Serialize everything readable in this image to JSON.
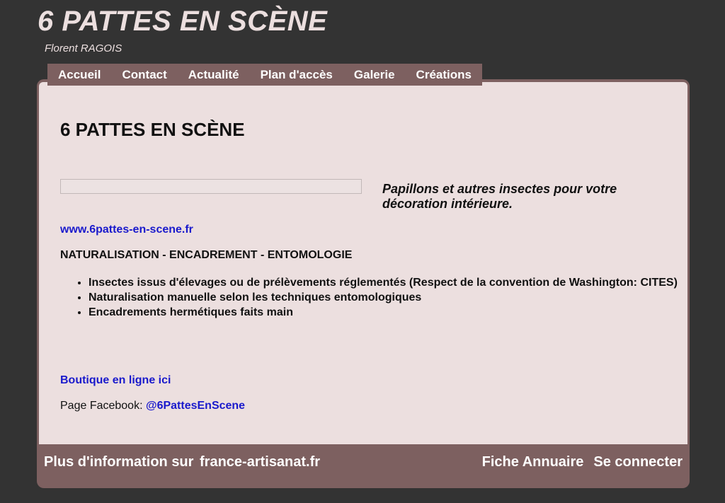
{
  "header": {
    "site_title": "6 PATTES EN SCÈNE",
    "subtitle": "Florent RAGOIS"
  },
  "nav": {
    "items": [
      {
        "label": "Accueil"
      },
      {
        "label": "Contact"
      },
      {
        "label": "Actualité"
      },
      {
        "label": "Plan d'accès"
      },
      {
        "label": "Galerie"
      },
      {
        "label": "Créations"
      }
    ]
  },
  "main": {
    "heading": "6 PATTES EN SCÈNE",
    "tagline": "Papillons et autres insectes pour votre décoration intérieure.",
    "website_link": "www.6pattes-en-scene.fr",
    "services": "NATURALISATION - ENCADREMENT - ENTOMOLOGIE",
    "features": [
      "Insectes issus d'élevages ou de prélèvements réglementés (Respect de la convention de Washington: CITES)",
      "Naturalisation manuelle selon les techniques entomologiques",
      "Encadrements hermétiques faits main"
    ],
    "boutique_link": "Boutique en ligne ici",
    "facebook_label": "Page Facebook: ",
    "facebook_link": "@6PattesEnScene"
  },
  "footer": {
    "info_prefix": "Plus d'information sur",
    "info_link": "france-artisanat.fr",
    "directory_link": "Fiche Annuaire",
    "login_link": "Se connecter"
  },
  "colors": {
    "background": "#333333",
    "accent": "#7d6060",
    "content_bg": "#ecdfdf",
    "link": "#1a1acc"
  }
}
